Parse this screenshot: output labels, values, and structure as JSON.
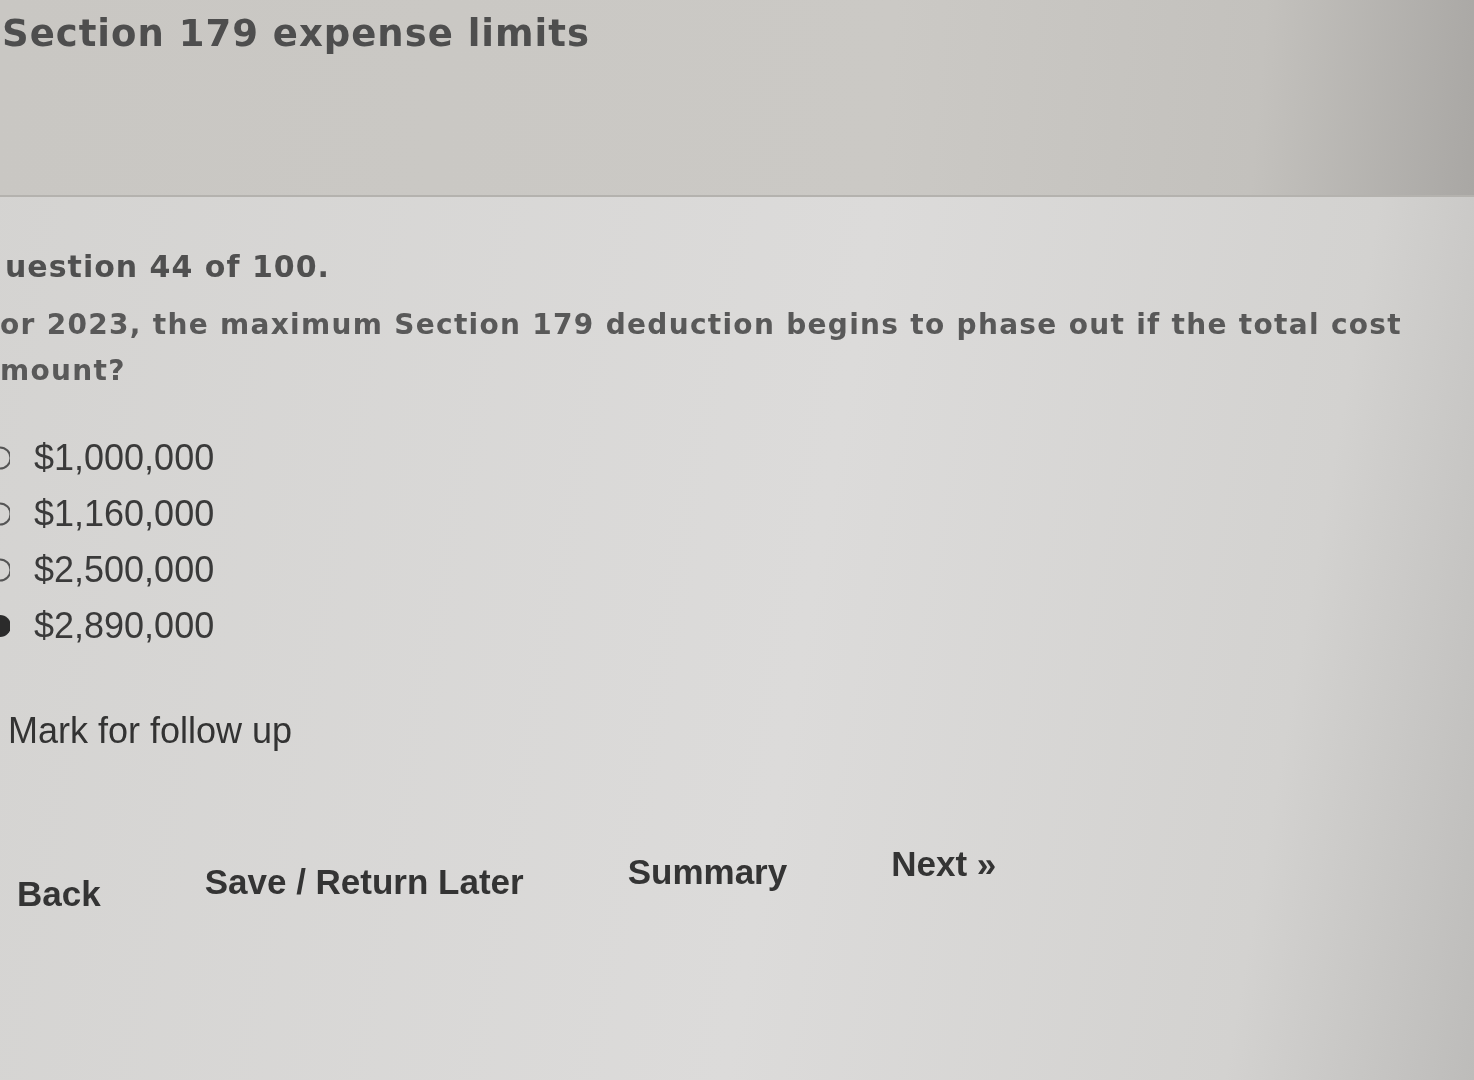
{
  "header": {
    "title": "Section 179 expense limits"
  },
  "question": {
    "number": "uestion 44 of 100.",
    "lines": [
      "or 2023, the maximum Section 179 deduction begins to phase out if the total cost",
      "mount?"
    ]
  },
  "options": [
    {
      "label": "$1,000,000",
      "selected": false
    },
    {
      "label": "$1,160,000",
      "selected": false
    },
    {
      "label": "$2,500,000",
      "selected": false
    },
    {
      "label": "$2,890,000",
      "selected": true
    }
  ],
  "follow_up": {
    "label": "Mark for follow up"
  },
  "buttons": [
    {
      "label": "Back"
    },
    {
      "label": "Save / Return Later"
    },
    {
      "label": "Summary"
    },
    {
      "label": "Next »"
    }
  ]
}
